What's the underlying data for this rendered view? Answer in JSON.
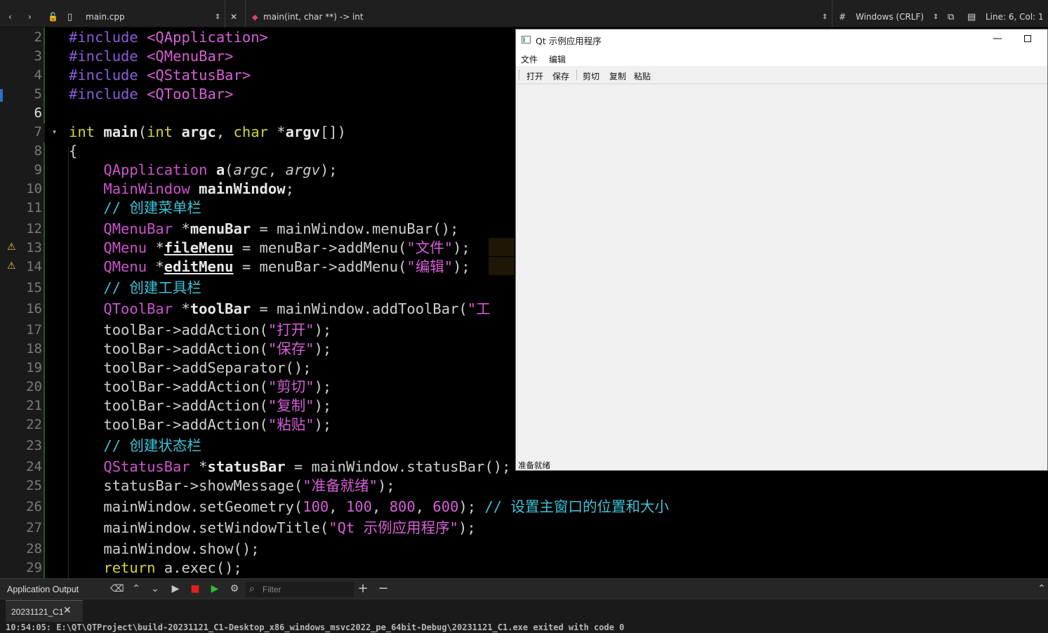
{
  "editor_toolbar": {
    "file_name": "main.cpp",
    "function_scope": "main(int, char **) -> int",
    "hash": "#",
    "line_ending": "Windows (CRLF)",
    "cursor_position": "Line: 6, Col: 1"
  },
  "code_lines": [
    {
      "n": "2"
    },
    {
      "n": "3"
    },
    {
      "n": "4"
    },
    {
      "n": "5"
    },
    {
      "n": "6"
    },
    {
      "n": "7"
    },
    {
      "n": "8"
    },
    {
      "n": "9"
    },
    {
      "n": "10"
    },
    {
      "n": "11"
    },
    {
      "n": "12"
    },
    {
      "n": "13"
    },
    {
      "n": "14"
    },
    {
      "n": "15"
    },
    {
      "n": "16"
    },
    {
      "n": "17"
    },
    {
      "n": "18"
    },
    {
      "n": "19"
    },
    {
      "n": "20"
    },
    {
      "n": "21"
    },
    {
      "n": "22"
    },
    {
      "n": "23"
    },
    {
      "n": "24"
    },
    {
      "n": "25"
    },
    {
      "n": "26"
    },
    {
      "n": "27"
    },
    {
      "n": "28"
    },
    {
      "n": "29"
    }
  ],
  "code": {
    "inc": "#include",
    "h1": "<QApplication>",
    "h2": "<QMenuBar>",
    "h3": "<QStatusBar>",
    "h4": "<QToolBar>",
    "int1": "int",
    "main": "main",
    "po": "(",
    "int2": "int",
    "argc": "argc",
    "comma": ",",
    "char": "char",
    "star": "*",
    "argv": "argv",
    "pc": "[])",
    "brace": "{",
    "qapp": "QApplication",
    "a": "a",
    "a_args_open": "(",
    "argc2": "argc",
    "argv2": "argv",
    "a_args_close": ");",
    "mw_type": "MainWindow",
    "mw_var": "mainWindow",
    "semi": ";",
    "c_menu": "// 创建菜单栏",
    "qmenubar": "QMenuBar",
    "menuBar_var": "menuBar",
    "l12_rest": " = mainWindow.menuBar();",
    "qmenu": "QMenu",
    "fileMenu": "fileMenu",
    "l13_rest": " = menuBar->addMenu(",
    "s_file": "\"文件\"",
    "close": ");",
    "editMenu": "editMenu",
    "s_edit": "\"编辑\"",
    "c_tool": "// 创建工具栏",
    "qtoolbar": "QToolBar",
    "toolBar_var": "toolBar",
    "l16_rest": " = mainWindow.addToolBar(",
    "s_tool_cut": "\"工",
    "addAction": "toolBar->addAction(",
    "s_open": "\"打开\"",
    "s_save": "\"保存\"",
    "addSeparator": "toolBar->addSeparator();",
    "s_cut": "\"剪切\"",
    "s_copy": "\"复制\"",
    "s_paste": "\"粘贴\"",
    "c_status": "// 创建状态栏",
    "qstatusbar": "QStatusBar",
    "statusBar_var": "statusBar",
    "l24_rest": " = mainWindow.statusBar(",
    "l24_tail": ");",
    "showMessage": "statusBar->showMessage(",
    "s_ready": "\"准备就绪\"",
    "setGeometry": "mainWindow.setGeometry(",
    "n100a": "100",
    "n100b": "100",
    "n800": "800",
    "n600": "600",
    "sep": ", ",
    "c_geom": "// 设置主窗口的位置和大小",
    "setTitle": "mainWindow.setWindowTitle(",
    "s_title": "\"Qt 示例应用程序\"",
    "show": "mainWindow.show();",
    "return": "return",
    "exec": " a.exec();"
  },
  "qt_window": {
    "title": "Qt 示例应用程序",
    "minimize_glyph": "—",
    "menus": [
      "文件",
      "编辑"
    ],
    "toolbar_actions": [
      "打开",
      "保存",
      "剪切",
      "复制",
      "粘贴"
    ],
    "status_message": "准备就绪"
  },
  "output_pane": {
    "title": "Application Output",
    "filter_placeholder": "Filter",
    "tab_label": "20231121_C1",
    "last_line": "10:54:05: E:\\QT\\QTProject\\build-20231121_C1-Desktop_x86_windows_msvc2022_pe_64bit-Debug\\20231121_C1.exe exited with code 0"
  },
  "colors": {
    "keyword": "#d3d33a",
    "type": "#cc53cc",
    "string": "#d75fd7",
    "comment": "#3ec3d8",
    "preprocessor": "#8a5cd8",
    "warning": "#e8c23a",
    "run_green": "#2fbf2f",
    "stop_red": "#e02020"
  }
}
